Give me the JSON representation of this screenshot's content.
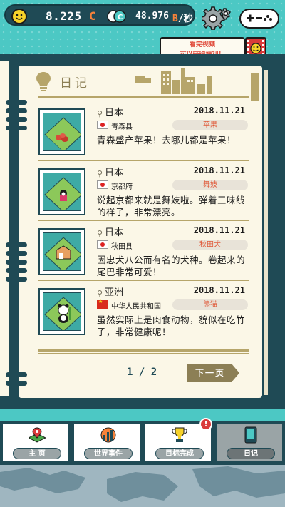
{
  "topbar": {
    "cash_value": "8.225",
    "cash_unit": "C",
    "rate_value": "48.976",
    "rate_unit": "B",
    "rate_per": "/秒"
  },
  "video_banner": {
    "line1": "看完视频",
    "line2": "可以获得福利！"
  },
  "diary": {
    "title": "日记",
    "entries": [
      {
        "region": "日本",
        "date": "2018.11.21",
        "flag": "jp",
        "place": "青森县",
        "tag": "苹果",
        "desc": "青森盛产苹果！去哪儿都是苹果！"
      },
      {
        "region": "日本",
        "date": "2018.11.21",
        "flag": "jp",
        "place": "京都府",
        "tag": "舞妓",
        "desc": "说起京都来就是舞妓啦。弹着三味线的样子，非常漂亮。"
      },
      {
        "region": "日本",
        "date": "2018.11.21",
        "flag": "jp",
        "place": "秋田县",
        "tag": "秋田犬",
        "desc": "因忠犬八公而有名的犬种。卷起来的尾巴非常可爱！"
      },
      {
        "region": "亚洲",
        "date": "2018.11.21",
        "flag": "cn",
        "place": "中华人民共和国",
        "tag": "熊猫",
        "desc": "虽然实际上是肉食动物，貌似在吃竹子，非常健康呢！"
      }
    ],
    "page_indicator": "1 / 2",
    "next_label": "下一页"
  },
  "tabs": [
    {
      "label": "主 页",
      "icon": "map-pin-icon"
    },
    {
      "label": "世界事件",
      "icon": "chart-icon"
    },
    {
      "label": "目标完成",
      "icon": "trophy-icon"
    },
    {
      "label": "日记",
      "icon": "notebook-icon"
    }
  ],
  "alert_badge": "!",
  "colors": {
    "accent": "#4cc8c4",
    "dark": "#1f4a55",
    "orange": "#f6823a",
    "paper": "#fbf7e7"
  }
}
